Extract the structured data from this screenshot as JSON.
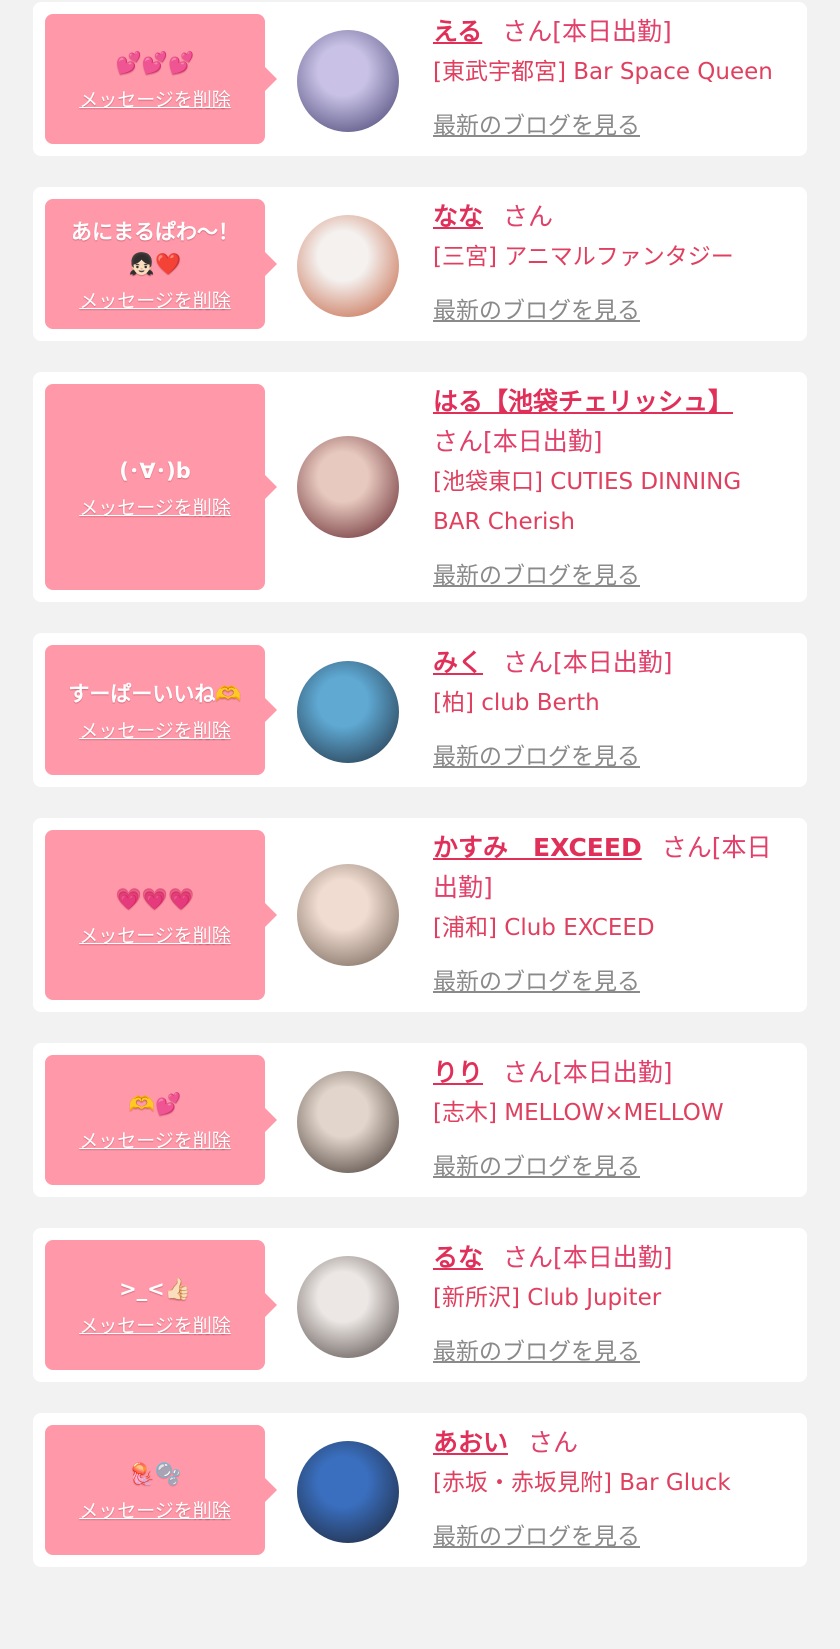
{
  "delete_label": "メッセージを削除",
  "blog_label": "最新のブログを見る",
  "colors": {
    "background": "#f2f2f2",
    "card": "#ffffff",
    "bubble": "#ff98a8",
    "name": "#e0305a",
    "text_pink": "#e0405f",
    "blog_gray": "#8a8a8a"
  },
  "entries": [
    {
      "message": "💕💕💕",
      "name": "える",
      "suffix": "さん[本日出勤]",
      "shop": "[東武宇都宮] Bar Space Queen",
      "avatar_colors": [
        "#c9c2e6",
        "#3c3a6a"
      ]
    },
    {
      "message": "あにまるぱわ〜！\n👧🏻❤️",
      "name": "なな",
      "suffix": "さん",
      "shop": "[三宮] アニマルファンタジー",
      "avatar_colors": [
        "#f4f1ef",
        "#c15a38"
      ]
    },
    {
      "message": "(･∀･)b",
      "name": "はる【池袋チェリッシュ】",
      "suffix": "さん[本日出勤]",
      "shop": "[池袋東口] CUTIES DINNING BAR Cherish",
      "avatar_colors": [
        "#e7c9bf",
        "#5b1a22"
      ]
    },
    {
      "message": "すーぱーいいね🫶",
      "name": "みく",
      "suffix": "さん[本日出勤]",
      "shop": "[柏] club Berth",
      "avatar_colors": [
        "#5fa9d3",
        "#1e2a3a"
      ]
    },
    {
      "message": "💗💗💗",
      "name": "かすみ　EXCEED",
      "suffix": "さん[本日出勤]",
      "shop": "[浦和] Club EXCEED",
      "avatar_colors": [
        "#f0dcd0",
        "#6a584c"
      ]
    },
    {
      "message": "🫶💕",
      "name": "りり",
      "suffix": "さん[本日出勤]",
      "shop": "[志木] MELLOW×MELLOW",
      "avatar_colors": [
        "#e2d6cc",
        "#3a2e28"
      ]
    },
    {
      "message": ">_<👍🏻",
      "name": "るな",
      "suffix": "さん[本日出勤]",
      "shop": "[新所沢] Club Jupiter",
      "avatar_colors": [
        "#ece7e4",
        "#4a3f3d"
      ]
    },
    {
      "message": "🪼🫧",
      "name": "あおい",
      "suffix": "さん",
      "shop": "[赤坂・赤坂見附] Bar Gluck",
      "avatar_colors": [
        "#3a6fbf",
        "#1c2230"
      ]
    }
  ]
}
